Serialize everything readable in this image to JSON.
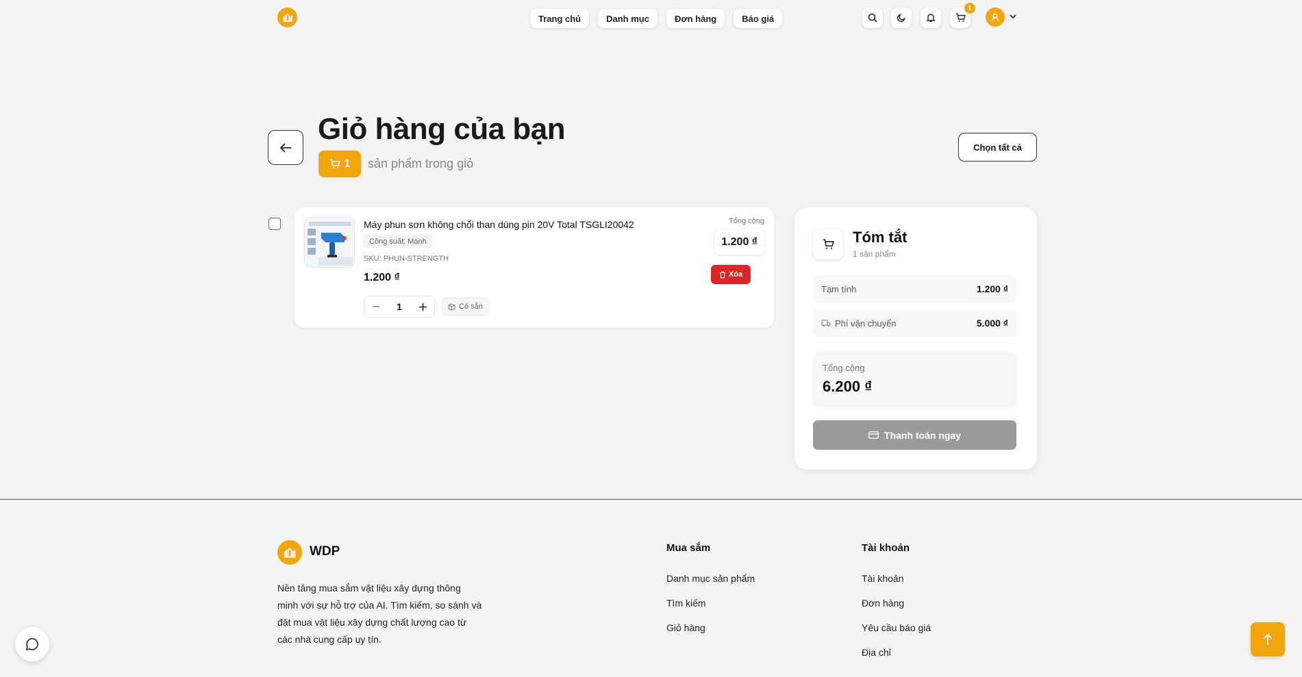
{
  "header": {
    "nav": [
      "Trang chủ",
      "Danh mục",
      "Đơn hàng",
      "Báo giá"
    ],
    "cart_count": "1",
    "icons": [
      "logo-icon",
      "search-icon",
      "moon-icon",
      "bell-icon",
      "cart-icon",
      "user-icon",
      "chevron-down-icon"
    ]
  },
  "page": {
    "title": "Giỏ hàng của bạn",
    "count": "1",
    "count_text": "sản phẩm trong giỏ",
    "select_all": "Chọn tất cả"
  },
  "items": [
    {
      "name": "Máy phun sơn không chổi than dùng pin 20V Total TSGLI20042",
      "variant": "Công suất: Mạnh",
      "sku": "SKU: PHUN-STRENGTH",
      "price": "1.200 ₫",
      "quantity": "1",
      "stock": "Có sẵn",
      "total_label": "Tổng cộng",
      "total": "1.200 ₫",
      "delete": "Xóa",
      "checked": false
    }
  ],
  "summary": {
    "title": "Tóm tắt",
    "subtitle": "1 sản phẩm",
    "subtotal_label": "Tạm tính",
    "subtotal": "1.200 ₫",
    "shipping_label": "Phí vận chuyển",
    "shipping": "5.000 ₫",
    "grand_label": "Tổng cộng",
    "grand_total": "6.200 ₫",
    "checkout": "Thanh toán ngay"
  },
  "footer": {
    "brand": "WDP",
    "description": "Nền tảng mua sắm vật liệu xây dựng thông minh với sự hỗ trợ của AI. Tìm kiếm, so sánh và đặt mua vật liệu xây dựng chất lượng cao từ các nhà cung cấp uy tín.",
    "shopping_title": "Mua sắm",
    "shopping_links": [
      "Danh mục sản phẩm",
      "Tìm kiếm",
      "Giỏ hàng"
    ],
    "account_title": "Tài khoản",
    "account_links": [
      "Tài khoản",
      "Đơn hàng",
      "Yêu cầu báo giá",
      "Địa chỉ"
    ]
  },
  "colors": {
    "accent": "#f4a50c",
    "danger": "#dc2626",
    "checkout_disabled": "#9a9a9a",
    "background": "#f4f4f4"
  }
}
